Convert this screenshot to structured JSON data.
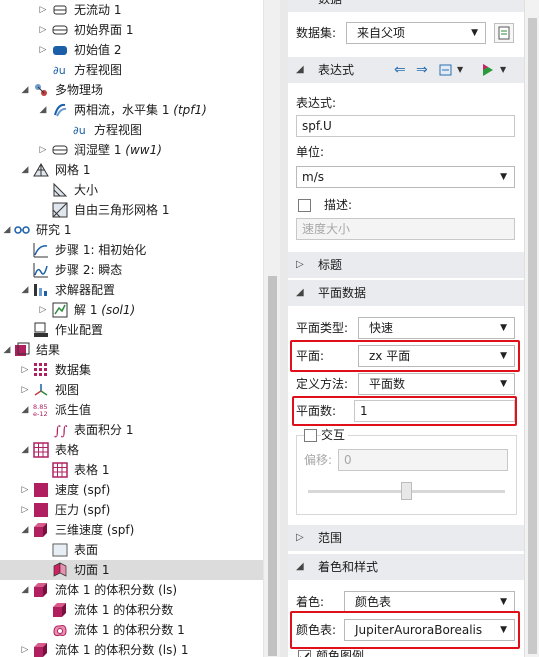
{
  "tree": {
    "rows": [
      {
        "label": "无流动 1",
        "suffix": ""
      },
      {
        "label": "初始界面 1",
        "suffix": ""
      },
      {
        "label": "初始值 2",
        "suffix": ""
      },
      {
        "label": "方程视图",
        "suffix": ""
      },
      {
        "label": "多物理场",
        "suffix": ""
      },
      {
        "label": "两相流，水平集 1 ",
        "suffix": "(tpf1)"
      },
      {
        "label": "方程视图",
        "suffix": ""
      },
      {
        "label": "润湿壁 1 ",
        "suffix": "(ww1)"
      },
      {
        "label": "网格 1",
        "suffix": ""
      },
      {
        "label": "大小",
        "suffix": ""
      },
      {
        "label": "自由三角形网格 1",
        "suffix": ""
      },
      {
        "label": "研究 1",
        "suffix": ""
      },
      {
        "label": "步骤 1: 相初始化",
        "suffix": ""
      },
      {
        "label": "步骤 2: 瞬态",
        "suffix": ""
      },
      {
        "label": "求解器配置",
        "suffix": ""
      },
      {
        "label": "解 1 ",
        "suffix": "(sol1)"
      },
      {
        "label": "作业配置",
        "suffix": ""
      },
      {
        "label": "结果",
        "suffix": ""
      },
      {
        "label": "数据集",
        "suffix": ""
      },
      {
        "label": "视图",
        "suffix": ""
      },
      {
        "label": "派生值",
        "suffix": ""
      },
      {
        "label": "表面积分 1",
        "suffix": ""
      },
      {
        "label": "表格",
        "suffix": ""
      },
      {
        "label": "表格 1",
        "suffix": ""
      },
      {
        "label": "速度 (spf)",
        "suffix": ""
      },
      {
        "label": "压力 (spf)",
        "suffix": ""
      },
      {
        "label": "三维速度 (spf)",
        "suffix": ""
      },
      {
        "label": "表面",
        "suffix": ""
      },
      {
        "label": "切面 1",
        "suffix": ""
      },
      {
        "label": "流体 1 的体积分数 (ls)",
        "suffix": ""
      },
      {
        "label": "流体 1 的体积分数",
        "suffix": ""
      },
      {
        "label": "流体 1 的体积分数 1",
        "suffix": ""
      },
      {
        "label": "流体 1 的体积分数 (ls) 1",
        "suffix": ""
      }
    ]
  },
  "settings": {
    "data_section_title": "数据",
    "dataset_label": "数据集:",
    "dataset_value": "来自父项",
    "expression_section": "表达式",
    "expression_label": "表达式:",
    "expression_value": "spf.U",
    "unit_label": "单位:",
    "unit_value": "m/s",
    "description_label": "描述:",
    "description_value": "速度大小",
    "title_section": "标题",
    "plane_data_section": "平面数据",
    "plane_type_label": "平面类型:",
    "plane_type_value": "快速",
    "plane_label": "平面:",
    "plane_value": "zx 平面",
    "entry_method_label": "定义方法:",
    "entry_method_value": "平面数",
    "planes_label": "平面数:",
    "planes_value": "1",
    "interactive_label": "交互",
    "shift_label": "偏移:",
    "shift_value": "0",
    "range_section": "范围",
    "coloring_section": "着色和样式",
    "coloring_label": "着色:",
    "coloring_value": "颜色表",
    "color_table_label": "颜色表:",
    "color_table_value": "JupiterAuroraBorealis",
    "color_legend_label": "颜色图例",
    "interactive_slider": 0.5
  },
  "colors": {
    "highlight_border": "#e0101a",
    "section_bg": "#e9ebee",
    "selected_row": "#dcdcdc"
  }
}
